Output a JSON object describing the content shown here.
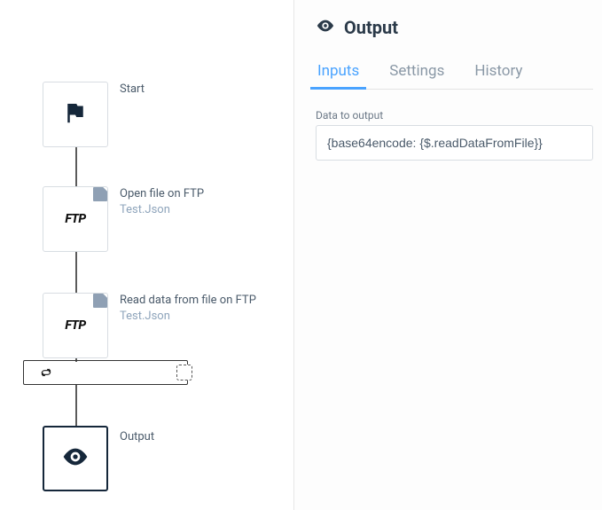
{
  "canvas": {
    "nodes": {
      "start": {
        "label": "Start"
      },
      "open_ftp": {
        "label": "Open file on FTP",
        "sub": "Test.Json",
        "icon_text": "FTP"
      },
      "read_ftp": {
        "label": "Read data from file on FTP",
        "sub": "Test.Json",
        "icon_text": "FTP"
      },
      "output": {
        "label": "Output"
      }
    }
  },
  "panel": {
    "title": "Output",
    "tabs": {
      "inputs": "Inputs",
      "settings": "Settings",
      "history": "History"
    },
    "form": {
      "data_to_output_label": "Data to output",
      "data_to_output_value": "{base64encode: {$.readDataFromFile}}"
    }
  }
}
